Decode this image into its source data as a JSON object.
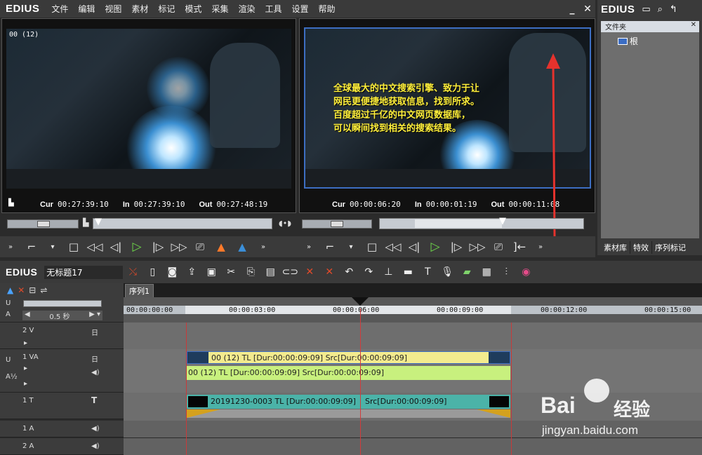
{
  "app": {
    "logo": "EDIUS",
    "menu": [
      "文件",
      "编辑",
      "视图",
      "素材",
      "标记",
      "模式",
      "采集",
      "渲染",
      "工具",
      "设置",
      "帮助"
    ],
    "minimize_label": "_",
    "close_label": "✕"
  },
  "player": {
    "clip_label": "00 (12)",
    "cur_label": "Cur",
    "cur_value": "00:27:39:10",
    "in_label": "In",
    "in_value": "00:27:39:10",
    "out_label": "Out",
    "out_value": "00:27:48:19"
  },
  "recorder": {
    "subtitle": "全球最大的中文搜索引擎、致力于让\n网民更便捷地获取信息，找到所求。\n百度超过千亿的中文网页数据库，\n可以瞬间找到相关的搜索结果。",
    "cur_label": "Cur",
    "cur_value": "00:00:06:20",
    "in_label": "In",
    "in_value": "00:00:01:19",
    "out_label": "Out",
    "out_value": "00:00:11:08"
  },
  "sidebar": {
    "logo": "EDIUS",
    "folder_header": "文件夹",
    "root_label": "根",
    "tabs": [
      "素材库",
      "特效",
      "序列标记"
    ]
  },
  "timeline": {
    "logo": "EDIUS",
    "project_name": "无标题17",
    "sequence_tab": "序列1",
    "zoom_label": "0.5 秒",
    "ruler_ticks": [
      "00:00:00:00",
      "00:00:03:00",
      "00:00:06:00",
      "00:00:09:00",
      "00:00:12:00",
      "00:00:15:00"
    ],
    "tracks": [
      {
        "name": "2 V"
      },
      {
        "name": "1 VA"
      },
      {
        "name": "1 T"
      },
      {
        "name": "1 A"
      },
      {
        "name": "2 A"
      }
    ],
    "clips": {
      "video_clip": "00 (12)   TL [Dur:00:00:09:09]   Src[Dur:00:00:09:09]",
      "audio_clip": "00 (12)   TL [Dur:00:00:09:09]   Src[Dur:00:00:09:09]",
      "title_clip_left": "20191230-0003   TL [Dur:00:00:09:09]",
      "title_clip_right": "Src[Dur:00:00:09:09]"
    }
  },
  "watermark": {
    "brand": "Bai",
    "brand_cn": "经验",
    "url": "jingyan.baidu.com"
  },
  "colors": {
    "accent_play": "#6ed84a",
    "arrow": "#e5322d",
    "subtitle": "#ffef3a",
    "clip_video": "#f3eb8e",
    "clip_audio": "#c8f07e",
    "clip_title": "#4bb3a8"
  }
}
